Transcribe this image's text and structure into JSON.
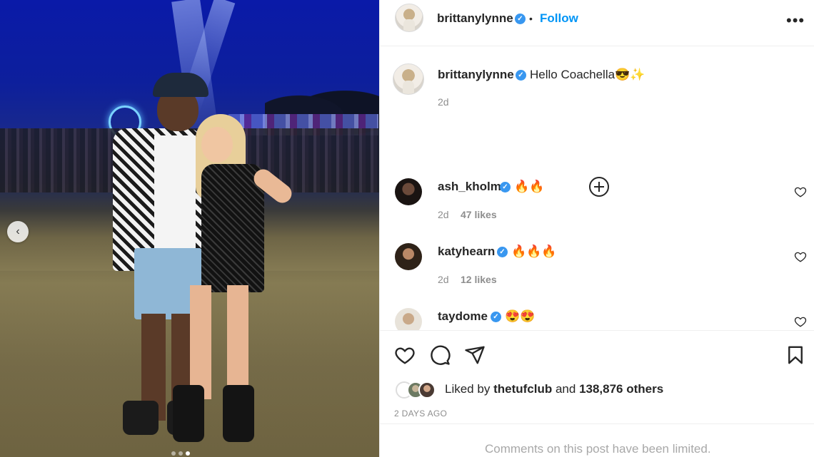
{
  "post": {
    "author": "brittanylynne",
    "follow_label": "Follow",
    "more_label": "•••",
    "separator": "•",
    "verified_mark": "✓",
    "caption": "Hello Coachella",
    "caption_emoji": "😎✨",
    "caption_age": "2d",
    "photo_alt": "carousel-photo",
    "carousel_prev": "‹",
    "carousel_dots": 3,
    "carousel_active_dot": 3
  },
  "comments": [
    {
      "username": "ash_kholm",
      "emoji": "🔥🔥",
      "age": "2d",
      "likes": "47 likes",
      "avatar_color": "#2a1d1a"
    },
    {
      "username": "katyhearn",
      "emoji": "🔥🔥🔥",
      "age": "2d",
      "likes": "12 likes",
      "avatar_color": "#3b2a1c"
    },
    {
      "username": "taydome",
      "emoji": "😍😍",
      "age": "",
      "likes": "",
      "avatar_color": "#d8d2c6"
    }
  ],
  "engagement": {
    "liked_by_prefix": "Liked by",
    "liked_by_user": "thetufclub",
    "liked_by_conj": "and",
    "liked_by_others": "138,876 others",
    "timestamp": "2 DAYS AGO",
    "comments_limited": "Comments on this post have been limited."
  },
  "icons": {
    "like": "heart-icon",
    "comment": "comment-icon",
    "share": "share-icon",
    "save": "bookmark-icon",
    "load_more": "plus-circle-icon",
    "more": "more-options-icon"
  },
  "colors": {
    "accent": "#0095f6",
    "verified": "#3897f0",
    "text": "#262626",
    "muted": "#8e8e8e",
    "border": "#efefef"
  }
}
